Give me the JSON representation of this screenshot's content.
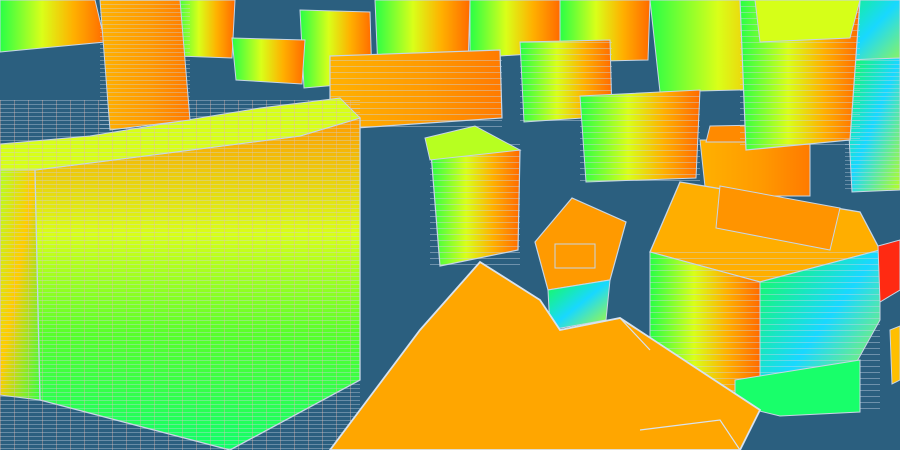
{
  "scene": {
    "kind": "3D city building heatmap render",
    "background_color": "#2b5f7f",
    "outline_color": "#c7d6e6",
    "heat_colors": {
      "cool": "#14c8ff",
      "low": "#18ff44",
      "mid": "#d6ff18",
      "warm": "#ffb000",
      "hot": "#ff7a00",
      "peak": "#ff1a1a"
    }
  }
}
